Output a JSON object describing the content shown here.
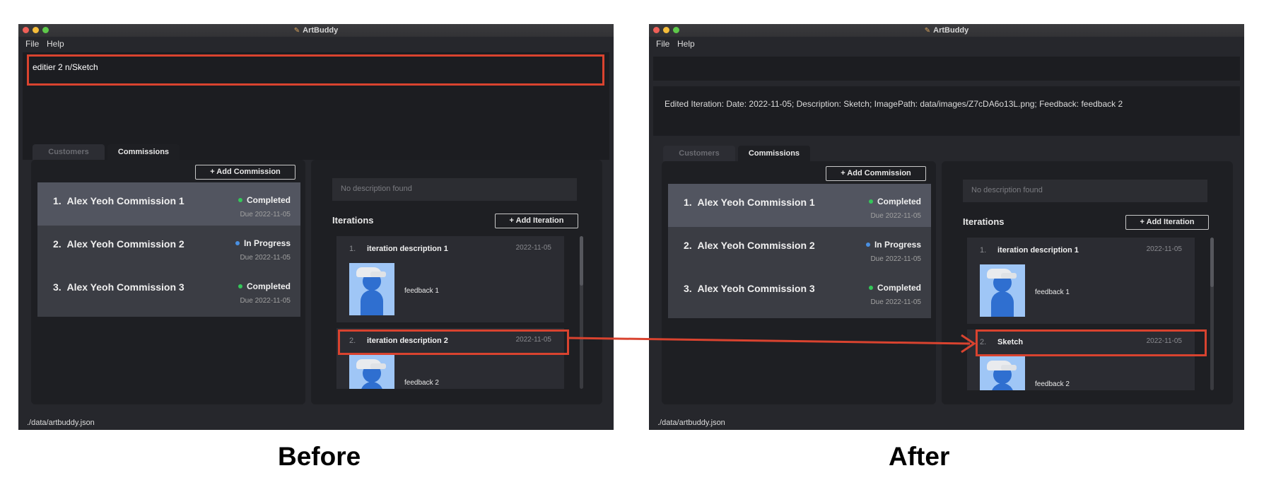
{
  "app": {
    "title": "ArtBuddy",
    "menu": [
      "File",
      "Help"
    ]
  },
  "tabs": {
    "customers": "Customers",
    "commissions": "Commissions"
  },
  "buttons": {
    "add_commission": "+   Add Commission",
    "add_iteration": "+   Add Iteration"
  },
  "description_placeholder": "No description found",
  "iterations_heading": "Iterations",
  "status_bar": "./data/artbuddy.json",
  "commissions": [
    {
      "index": "1.",
      "name": "Alex Yeoh Commission 1",
      "status": "Completed",
      "due": "Due 2022-11-05",
      "status_color": "#34c759"
    },
    {
      "index": "2.",
      "name": "Alex Yeoh Commission 2",
      "status": "In Progress",
      "due": "Due 2022-11-05",
      "status_color": "#4a90e2"
    },
    {
      "index": "3.",
      "name": "Alex Yeoh Commission 3",
      "status": "Completed",
      "due": "Due 2022-11-05",
      "status_color": "#34c759"
    }
  ],
  "before": {
    "command_input": "editier 2 n/Sketch",
    "iterations": [
      {
        "index": "1.",
        "title": "iteration description 1",
        "date": "2022-11-05",
        "feedback": "feedback 1"
      },
      {
        "index": "2.",
        "title": "iteration description 2",
        "date": "2022-11-05",
        "feedback": "feedback 2"
      }
    ]
  },
  "after": {
    "command_input": "",
    "result_text": "Edited Iteration: Date: 2022-11-05; Description: Sketch; ImagePath: data/images/Z7cDA6o13L.png; Feedback: feedback 2",
    "iterations": [
      {
        "index": "1.",
        "title": "iteration description 1",
        "date": "2022-11-05",
        "feedback": "feedback 1"
      },
      {
        "index": "2.",
        "title": "Sketch",
        "date": "2022-11-05",
        "feedback": "feedback 2"
      }
    ]
  },
  "captions": {
    "before": "Before",
    "after": "After"
  },
  "colors": {
    "highlight": "#d9432f",
    "window_bg": "#26272c",
    "panel_bg": "#1e1f23",
    "selected_card": "#525560"
  }
}
